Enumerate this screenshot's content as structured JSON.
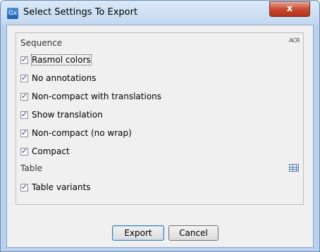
{
  "window": {
    "app_icon": "Gx",
    "title": "Select Settings To Export",
    "close_glyph": "x"
  },
  "sequence": {
    "label": "Sequence",
    "icon_label": "ACR",
    "items": [
      {
        "label": "Rasmol colors",
        "checked": true
      },
      {
        "label": "No annotations",
        "checked": true
      },
      {
        "label": "Non-compact with translations",
        "checked": true
      },
      {
        "label": "Show translation",
        "checked": true
      },
      {
        "label": "Non-compact (no wrap)",
        "checked": true
      },
      {
        "label": "Compact",
        "checked": true
      }
    ]
  },
  "table": {
    "label": "Table",
    "icon": "table-icon",
    "items": [
      {
        "label": "Table variants",
        "checked": true
      }
    ]
  },
  "buttons": {
    "export": "Export",
    "cancel": "Cancel"
  }
}
